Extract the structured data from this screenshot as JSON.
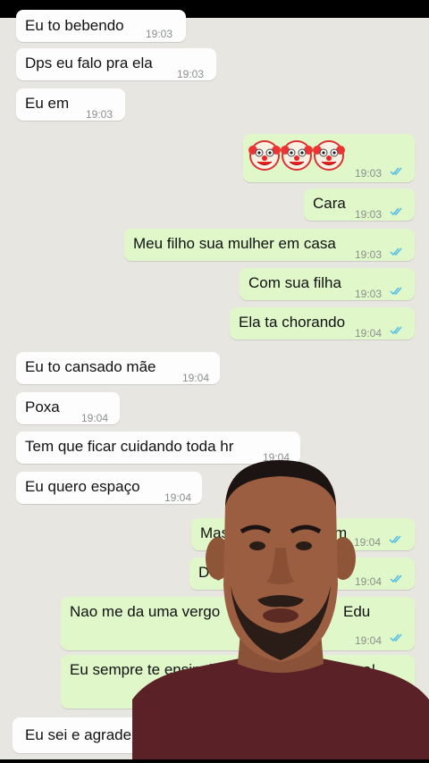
{
  "chat": {
    "messages": [
      {
        "dir": "in",
        "text": "Eu to bebendo",
        "time": "19:03"
      },
      {
        "dir": "in",
        "text": "Dps eu falo pra ela",
        "time": "19:03"
      },
      {
        "dir": "in",
        "text": "Eu em",
        "time": "19:03"
      },
      {
        "dir": "out",
        "text": "",
        "time": "19:03",
        "emoji": "clown-face"
      },
      {
        "dir": "out",
        "text": "Cara",
        "time": "19:03"
      },
      {
        "dir": "out",
        "text": "Meu filho sua mulher em casa",
        "time": "19:03"
      },
      {
        "dir": "out",
        "text": "Com sua filha",
        "time": "19:03"
      },
      {
        "dir": "out",
        "text": "Ela ta chorando",
        "time": "19:04"
      },
      {
        "dir": "in",
        "text": "Eu to cansado mãe",
        "time": "19:04"
      },
      {
        "dir": "in",
        "text": "Poxa",
        "time": "19:04"
      },
      {
        "dir": "in",
        "text": "Tem que ficar cuidando toda hr",
        "time": "19:04"
      },
      {
        "dir": "in",
        "text": "Eu quero espaço",
        "time": "19:04"
      },
      {
        "dir": "out",
        "text": "Mas",
        "text_right": "m",
        "time": "19:04"
      },
      {
        "dir": "out",
        "text": "Dej",
        "time": "19:04"
      },
      {
        "dir": "out",
        "text": "Nao me da uma vergo",
        "text_right": "Edu",
        "time": "19:04"
      },
      {
        "dir": "out",
        "text": "Eu sempre te ensinei t",
        "text_right": "forma!",
        "time": ""
      },
      {
        "dir": "in",
        "text": "Eu sei e agrade",
        "time": ""
      }
    ]
  },
  "colors": {
    "background": "#e8e6e1",
    "incoming_bubble": "#fdfdfd",
    "outgoing_bubble": "#dff7c9",
    "read_ticks": "#53bdeb"
  },
  "icons": {
    "read_receipt": "double-check-icon",
    "emoji": "clown-face-emoji"
  },
  "overlay": {
    "type": "reaction-video-person"
  }
}
